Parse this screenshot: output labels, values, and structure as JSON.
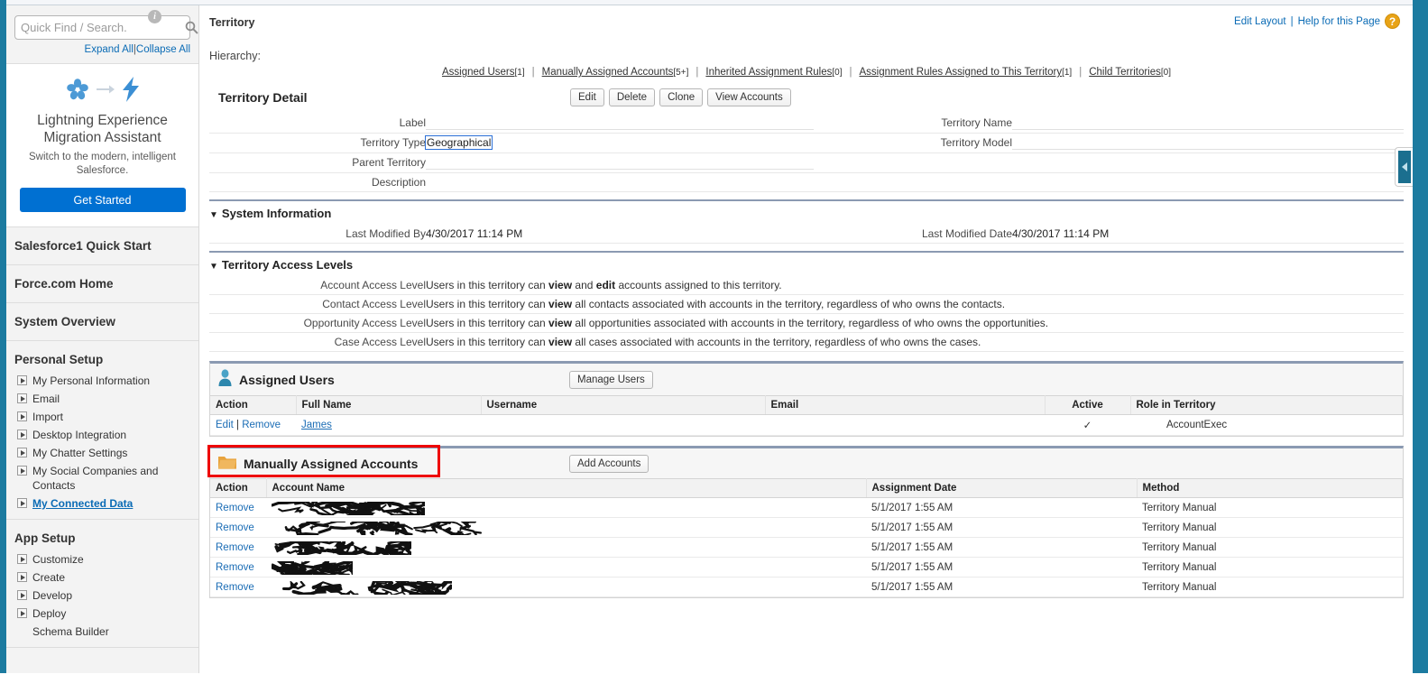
{
  "sidebar": {
    "search": {
      "placeholder": "Quick Find / Search.",
      "value": "",
      "info_icon": "i",
      "search_icon": "search-icon"
    },
    "expand_all": "Expand All",
    "collapse_all": "Collapse All",
    "separator": "|",
    "lex_card": {
      "icon_from": "salesforce-cloud-flower-icon",
      "icon_arrow": "arrow-right-icon",
      "icon_to": "lightning-bolt-icon",
      "title_line1": "Lightning Experience",
      "title_line2": "Migration Assistant",
      "subtitle": "Switch to the modern, intelligent Salesforce.",
      "button": "Get Started"
    },
    "top_links": [
      "Salesforce1 Quick Start",
      "Force.com Home",
      "System Overview"
    ],
    "sections": [
      {
        "title": "Personal Setup",
        "items": [
          {
            "label": "My Personal Information",
            "expandable": true,
            "link": false
          },
          {
            "label": "Email",
            "expandable": true,
            "link": false
          },
          {
            "label": "Import",
            "expandable": true,
            "link": false
          },
          {
            "label": "Desktop Integration",
            "expandable": true,
            "link": false
          },
          {
            "label": "My Chatter Settings",
            "expandable": true,
            "link": false
          },
          {
            "label": "My Social Companies and Contacts",
            "expandable": true,
            "link": false
          },
          {
            "label": "My Connected Data",
            "expandable": true,
            "link": true
          }
        ]
      },
      {
        "title": "App Setup",
        "items": [
          {
            "label": "Customize",
            "expandable": true,
            "link": false
          },
          {
            "label": "Create",
            "expandable": true,
            "link": false
          },
          {
            "label": "Develop",
            "expandable": true,
            "link": false
          },
          {
            "label": "Deploy",
            "expandable": true,
            "link": false
          },
          {
            "label": "Schema Builder",
            "expandable": false,
            "link": false
          }
        ]
      }
    ]
  },
  "header": {
    "kicker": "Territory",
    "hierarchy_label": "Hierarchy:",
    "edit_layout": "Edit Layout",
    "separator": "|",
    "help_link": "Help for this Page",
    "help_icon": "?"
  },
  "quicklinks": [
    {
      "label": "Assigned Users",
      "count": "[1]"
    },
    {
      "label": "Manually Assigned Accounts",
      "count": "[5+]"
    },
    {
      "label": "Inherited Assignment Rules",
      "count": "[0]"
    },
    {
      "label": "Assignment Rules Assigned to This Territory",
      "count": "[1]"
    },
    {
      "label": "Child Territories",
      "count": "[0]"
    }
  ],
  "territory_detail": {
    "title": "Territory Detail",
    "buttons": [
      "Edit",
      "Delete",
      "Clone",
      "View Accounts"
    ],
    "rows": [
      {
        "left_label": "Label",
        "left_value": "",
        "right_label": "Territory Name",
        "right_value": ""
      },
      {
        "left_label": "Territory Type",
        "left_value": "Geographical",
        "right_label": "Territory Model",
        "right_value": ""
      },
      {
        "left_label": "Parent Territory",
        "left_value": "",
        "right_label": "",
        "right_value": ""
      },
      {
        "left_label": "Description",
        "left_value": "",
        "right_label": "",
        "right_value": ""
      }
    ]
  },
  "system_information": {
    "title": "System Information",
    "caret": "▼",
    "left_label": "Last Modified By",
    "left_value": "4/30/2017 11:14 PM",
    "right_label": "Last Modified Date",
    "right_value": "4/30/2017 11:14 PM"
  },
  "access_levels": {
    "title": "Territory Access Levels",
    "caret": "▼",
    "rows": [
      {
        "label": "Account Access Level",
        "prefix": "Users in this territory can ",
        "kw1": "view",
        "mid": " and ",
        "kw2": "edit",
        "suffix": " accounts assigned to this territory."
      },
      {
        "label": "Contact Access Level",
        "prefix": "Users in this territory can ",
        "kw1": "view",
        "mid": "",
        "kw2": "",
        "suffix": " all contacts associated with accounts in the territory, regardless of who owns the contacts."
      },
      {
        "label": "Opportunity Access Level",
        "prefix": "Users in this territory can ",
        "kw1": "view",
        "mid": "",
        "kw2": "",
        "suffix": " all opportunities associated with accounts in the territory, regardless of who owns the opportunities."
      },
      {
        "label": "Case Access Level",
        "prefix": "Users in this territory can ",
        "kw1": "view",
        "mid": "",
        "kw2": "",
        "suffix": " all cases associated with accounts in the territory, regardless of who owns the cases."
      }
    ]
  },
  "assigned_users": {
    "title": "Assigned Users",
    "icon": "user-icon",
    "button": "Manage Users",
    "columns": [
      "Action",
      "Full Name",
      "Username",
      "Email",
      "Active",
      "Role in Territory"
    ],
    "rows": [
      {
        "action_edit": "Edit",
        "action_sep": "|",
        "action_remove": "Remove",
        "full_name": "James",
        "username": "",
        "email": "",
        "active": "✓",
        "role": "AccountExec"
      }
    ]
  },
  "manually_assigned_accounts": {
    "title": "Manually Assigned Accounts",
    "icon": "folder-icon",
    "button": "Add Accounts",
    "highlight_color": "#ee0000",
    "columns": [
      "Action",
      "Account Name",
      "Assignment Date",
      "Method"
    ],
    "rows": [
      {
        "action": "Remove",
        "account_name": "",
        "redacted": true,
        "redact_width": 170,
        "assignment_date": "5/1/2017 1:55 AM",
        "method": "Territory Manual"
      },
      {
        "action": "Remove",
        "account_name": "",
        "redacted": true,
        "redact_width": 240,
        "assignment_date": "5/1/2017 1:55 AM",
        "method": "Territory Manual"
      },
      {
        "action": "Remove",
        "account_name": "",
        "redacted": true,
        "redact_width": 155,
        "assignment_date": "5/1/2017 1:55 AM",
        "method": "Territory Manual"
      },
      {
        "action": "Remove",
        "account_name": "",
        "redacted": true,
        "redact_width": 90,
        "assignment_date": "5/1/2017 1:55 AM",
        "method": "Territory Manual"
      },
      {
        "action": "Remove",
        "account_name": "",
        "redacted": true,
        "redact_width": 200,
        "assignment_date": "5/1/2017 1:55 AM",
        "method": "Territory Manual"
      }
    ]
  },
  "right_panel": {
    "collapse_icon": "chevron-left-icon"
  }
}
